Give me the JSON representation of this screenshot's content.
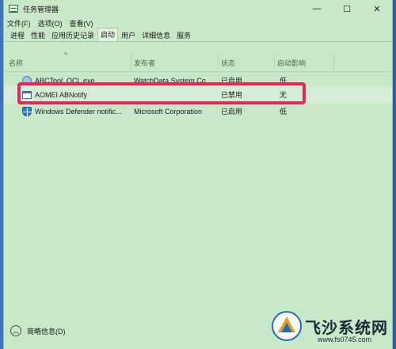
{
  "window": {
    "title": "任务管理器",
    "buttons": {
      "minimize": "—",
      "maximize": "☐",
      "close": "✕"
    }
  },
  "menu": [
    {
      "label": "文件(F)"
    },
    {
      "label": "选项(O)"
    },
    {
      "label": "查看(V)"
    }
  ],
  "tabs": [
    {
      "label": "进程"
    },
    {
      "label": "性能"
    },
    {
      "label": "应用历史记录"
    },
    {
      "label": "启动",
      "active": true
    },
    {
      "label": "用户"
    },
    {
      "label": "详细信息"
    },
    {
      "label": "服务"
    }
  ],
  "columns": {
    "name": "名称",
    "publisher": "发布者",
    "status": "状态",
    "impact": "启动影响"
  },
  "rows": [
    {
      "name": "ABCTool_OCL.exe",
      "publisher": "WatchData System Co...",
      "status": "已启用",
      "impact": "低",
      "icon": "globe-icon"
    },
    {
      "name": "AOMEI ABNotify",
      "publisher": "",
      "status": "已禁用",
      "impact": "无",
      "icon": "window-icon",
      "selected": true
    },
    {
      "name": "Windows Defender notific...",
      "publisher": "Microsoft Corporation",
      "status": "已启用",
      "impact": "低",
      "icon": "shield-icon"
    }
  ],
  "footer": {
    "label": "简略信息(D)",
    "icon": "chevron-up-icon"
  },
  "watermark": {
    "title": "飞沙系统网",
    "url": "www.fs0745.com"
  },
  "colors": {
    "highlight": "#e8265c",
    "background": "#c8e8c8"
  }
}
